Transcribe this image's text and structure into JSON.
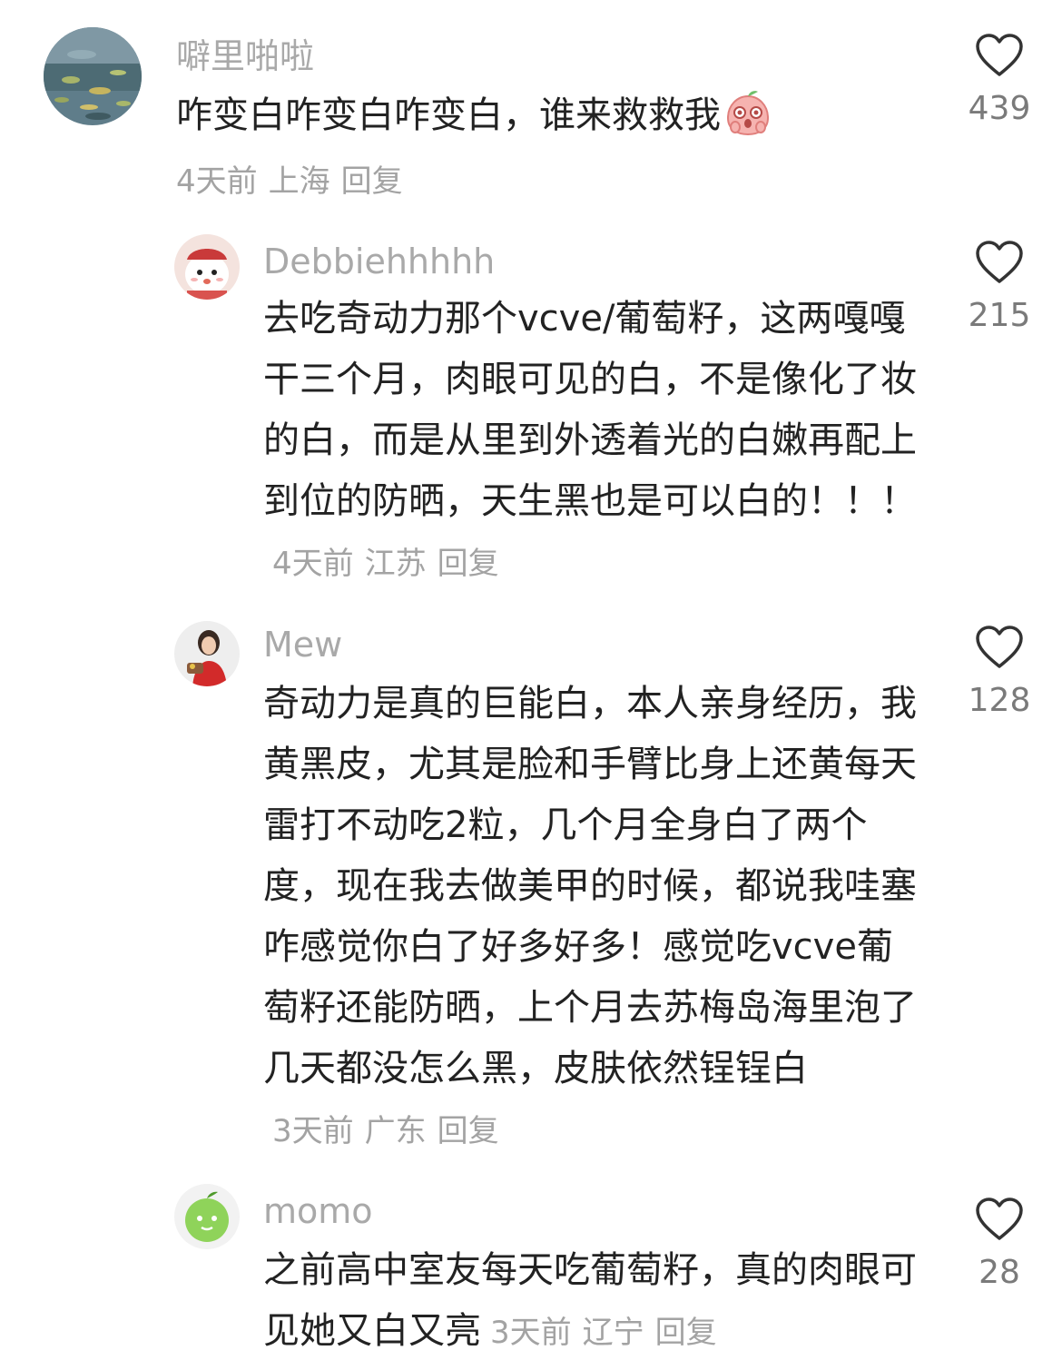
{
  "comments": [
    {
      "username": "噼里啪啦",
      "text": "咋变白咋变白咋变白，谁来救救我",
      "emoji": "shocked-peach-emoji",
      "time": "4天前",
      "location": "上海",
      "reply": "回复",
      "likes": "439",
      "avatar": "water-lily-painting-avatar"
    },
    {
      "username": "Debbiehhhhh",
      "text": "去吃奇动力那个vcve/葡萄籽，这两嘎嘎干三个月，肉眼可见的白，不是像化了妆的白，而是从里到外透着光的白嫩再配上到位的防晒，天生黑也是可以白的！！！",
      "time": "4天前",
      "location": "江苏",
      "reply": "回复",
      "likes": "215",
      "avatar": "cartoon-character-avatar"
    },
    {
      "username": "Mew",
      "text": "奇动力是真的巨能白，本人亲身经历，我黄黑皮，尤其是脸和手臂比身上还黄每天雷打不动吃2粒，几个月全身白了两个度，现在我去做美甲的时候，都说我哇塞咋感觉你白了好多好多！感觉吃vcve葡萄籽还能防晒，上个月去苏梅岛海里泡了几天都没怎么黑，皮肤依然锃锃白",
      "time": "3天前",
      "location": "广东",
      "reply": "回复",
      "likes": "128",
      "avatar": "girl-photo-avatar"
    },
    {
      "username": "momo",
      "text": "之前高中室友每天吃葡萄籽，真的肉眼可见她又白又亮",
      "time": "3天前",
      "location": "辽宁",
      "reply": "回复",
      "likes": "28",
      "avatar": "green-apple-avatar"
    }
  ],
  "colors": {
    "text": "#222222",
    "username": "#a9a9a9",
    "meta": "#a3a3a3",
    "count": "#7a7a7a"
  }
}
